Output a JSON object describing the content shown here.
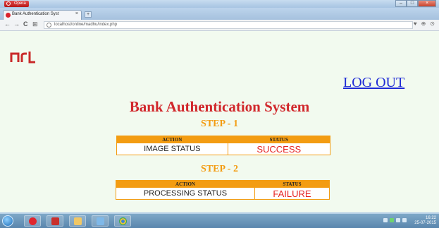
{
  "browser": {
    "menu_label": "Opera",
    "tab_title": "Bank Authentication Syst",
    "tab_close": "×",
    "new_tab": "+",
    "url": "localhost/online/madhu/index.php",
    "win_min": "–",
    "win_max": "□",
    "win_close": "×"
  },
  "nav": {
    "back": "←",
    "forward": "→",
    "reload": "C",
    "speed_dial": "⊞"
  },
  "toolbar_right": {
    "heart": "♥",
    "download": "⊕",
    "account": "⊙"
  },
  "page": {
    "logout": "LOG OUT",
    "title": "Bank Authentication System",
    "step1": {
      "label": "STEP - 1",
      "headers": [
        "ACTION",
        "STATUS"
      ],
      "action": "IMAGE STATUS",
      "status": "SUCCESS"
    },
    "step2": {
      "label": "STEP - 2",
      "headers": [
        "ACTION",
        "STATUS"
      ],
      "action": "PROCESSING STATUS",
      "status": "FAILURE"
    }
  },
  "taskbar": {
    "clock_time": "16:22",
    "clock_date": "25-07-2015"
  },
  "colors": {
    "title_red": "#d1282c",
    "step_orange": "#f39c12",
    "link_blue": "#1f2bd6",
    "page_bg": "#f2faef",
    "logo_red": "#c92a2a"
  },
  "icons": [
    "opera-icon",
    "speed-dial-icon",
    "heart-icon",
    "download-icon",
    "account-icon",
    "start-orb-icon",
    "opera-taskbar-icon",
    "pdf-taskbar-icon",
    "explorer-taskbar-icon",
    "paint-taskbar-icon",
    "chrome-taskbar-icon"
  ]
}
